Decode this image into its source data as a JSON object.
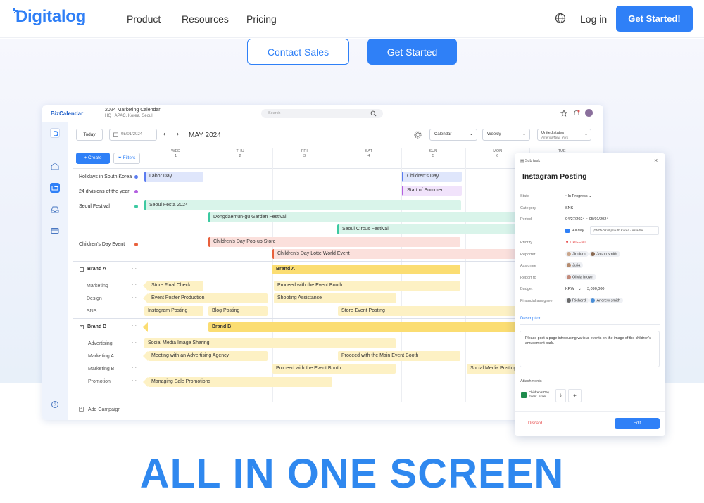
{
  "nav": {
    "logo": "Digitalog",
    "links": [
      "Product",
      "Resources",
      "Pricing"
    ],
    "login": "Log in",
    "cta": "Get Started!"
  },
  "hero": {
    "contact": "Contact Sales",
    "start": "Get Started"
  },
  "app": {
    "brand": "BizCalendar",
    "calendar_title": "2024 Marketing Calendar",
    "calendar_sub": "HQ , APAC, Korea, Seoul",
    "search_placeholder": "Search",
    "today": "Today",
    "date": "05/01/2024",
    "month": "MAY 2024",
    "view": "Calendar",
    "period": "Weekly",
    "region": "United states",
    "region_sub": "America/New_York",
    "create": "+ Create",
    "filters": "Filters",
    "days": [
      {
        "dow": "WED",
        "num": "1"
      },
      {
        "dow": "THU",
        "num": "2"
      },
      {
        "dow": "FRI",
        "num": "3"
      },
      {
        "dow": "SAT",
        "num": "4"
      },
      {
        "dow": "SUN",
        "num": "5"
      },
      {
        "dow": "MON",
        "num": "6"
      },
      {
        "dow": "TUE",
        "num": "7"
      }
    ],
    "holidays": [
      "Holidays in South Korea",
      "24 divisions of the year",
      "Seoul Festival",
      "Children's Day Event"
    ],
    "events": {
      "labor": "Labor Day",
      "children": "Children's Day",
      "summer": "Start of Summer",
      "festa": "Seoul Festa 2024",
      "garden": "Dongdaemun-gu Garden Festival",
      "circus": "Seoul Circus Festival",
      "popup": "Children's Day Pop-up Store",
      "lotte": "Children's Day Lotte World Event"
    },
    "brand_a": "Brand A",
    "brand_a_rows": [
      "Marketing",
      "Design",
      "SNS"
    ],
    "brand_a_tasks": {
      "store_check": "Store Final Check",
      "booth": "Proceed with the Event Booth",
      "poster": "Event Poster Production",
      "shooting": "Shooting Assistance",
      "insta": "Instagram Posting",
      "blog": "Blog Posting",
      "store_post": "Store Event Posting"
    },
    "brand_b": "Brand B",
    "brand_b_rows": [
      "Advertising",
      "Marketing A",
      "Marketing B",
      "Promotion"
    ],
    "brand_b_tasks": {
      "social": "Social Media Image Sharing",
      "meeting": "Meeting with an Advertising Agency",
      "main_booth": "Proceed with the Main Event Booth",
      "booth": "Proceed with the Event Booth",
      "social_post": "Social Media Posting",
      "promo": "Managing Sale Promotions"
    },
    "add_campaign": "Add Campaign"
  },
  "panel": {
    "crumb": "Sub task",
    "title": "Instagram Posting",
    "fields": {
      "state_l": "State",
      "state_v": "In Progress",
      "category_l": "Category",
      "category_v": "SNS",
      "period_l": "Period",
      "period_v": "04/27/2024  ~  05/01/2024",
      "allday": "All day",
      "tz": "(GMT+09:00)South Korea - Asia/Se...",
      "priority_l": "Priority",
      "priority_v": "URGENT",
      "reporter_l": "Reporter",
      "reporter_a": "Jim kim",
      "reporter_b": "Jason smith",
      "assignee_l": "Assignee",
      "assignee_v": "Julia",
      "reportto_l": "Report to",
      "reportto_v": "Olivia brown",
      "budget_l": "Budget",
      "budget_cur": "KRW",
      "budget_v": "3,090,000",
      "fin_l": "Financial assignee",
      "fin_a": "Richard",
      "fin_b": "Andrew smith"
    },
    "tab": "Description",
    "description": "Please post a page introducing various events on the image of the children's amusement park.",
    "attachments": "Attachments",
    "file": "Children's Day Event .excel",
    "discard": "Discard",
    "edit": "Edit"
  },
  "headline": "ALL IN ONE SCREEN",
  "colors": {
    "accent": "#2f80f7",
    "urgent": "#e85454",
    "brand_bar": "#fbdd72",
    "task_bar": "#fdf1c4"
  }
}
